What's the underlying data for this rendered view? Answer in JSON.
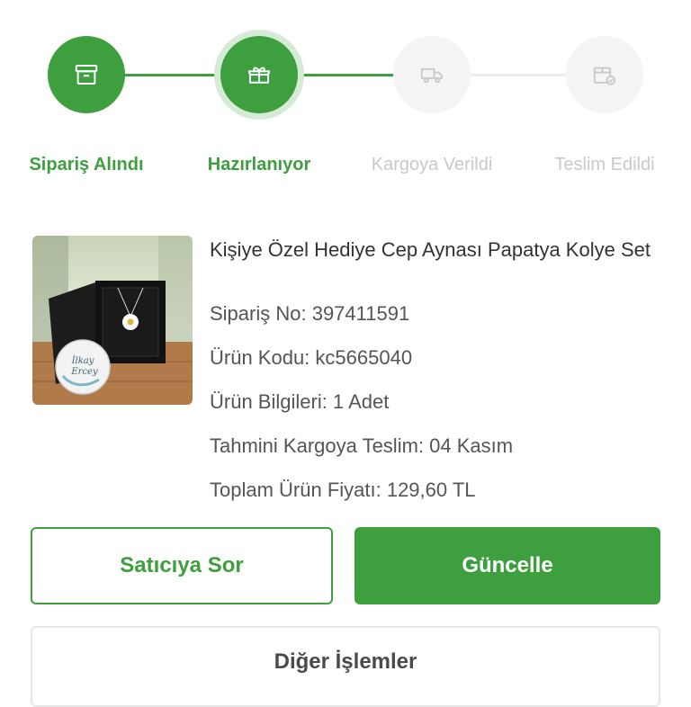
{
  "steps": [
    {
      "label": "Sipariş Alındı",
      "icon": "archive-box-icon",
      "status": "done"
    },
    {
      "label": "Hazırlanıyor",
      "icon": "gift-box-icon",
      "status": "current"
    },
    {
      "label": "Kargoya Verildi",
      "icon": "delivery-truck-icon",
      "status": "pending"
    },
    {
      "label": "Teslim Edildi",
      "icon": "delivered-box-icon",
      "status": "pending"
    }
  ],
  "product": {
    "title": "Kişiye Özel Hediye Cep Aynası Papatya Kolye Set",
    "image_text": "İlkay Ercey",
    "order_no": "Sipariş No: 397411591",
    "product_code": "Ürün Kodu: kc5665040",
    "product_info": "Ürün Bilgileri: 1 Adet",
    "estimated_shipping": "Tahmini Kargoya Teslim: 04 Kasım",
    "total_price": "Toplam Ürün Fiyatı: 129,60 TL"
  },
  "actions": {
    "ask_seller": "Satıcıya Sor",
    "update": "Güncelle",
    "other_actions": "Diğer İşlemler"
  },
  "colors": {
    "primary_green": "#3e9f3e",
    "inactive_gray": "#c9c9c9"
  }
}
